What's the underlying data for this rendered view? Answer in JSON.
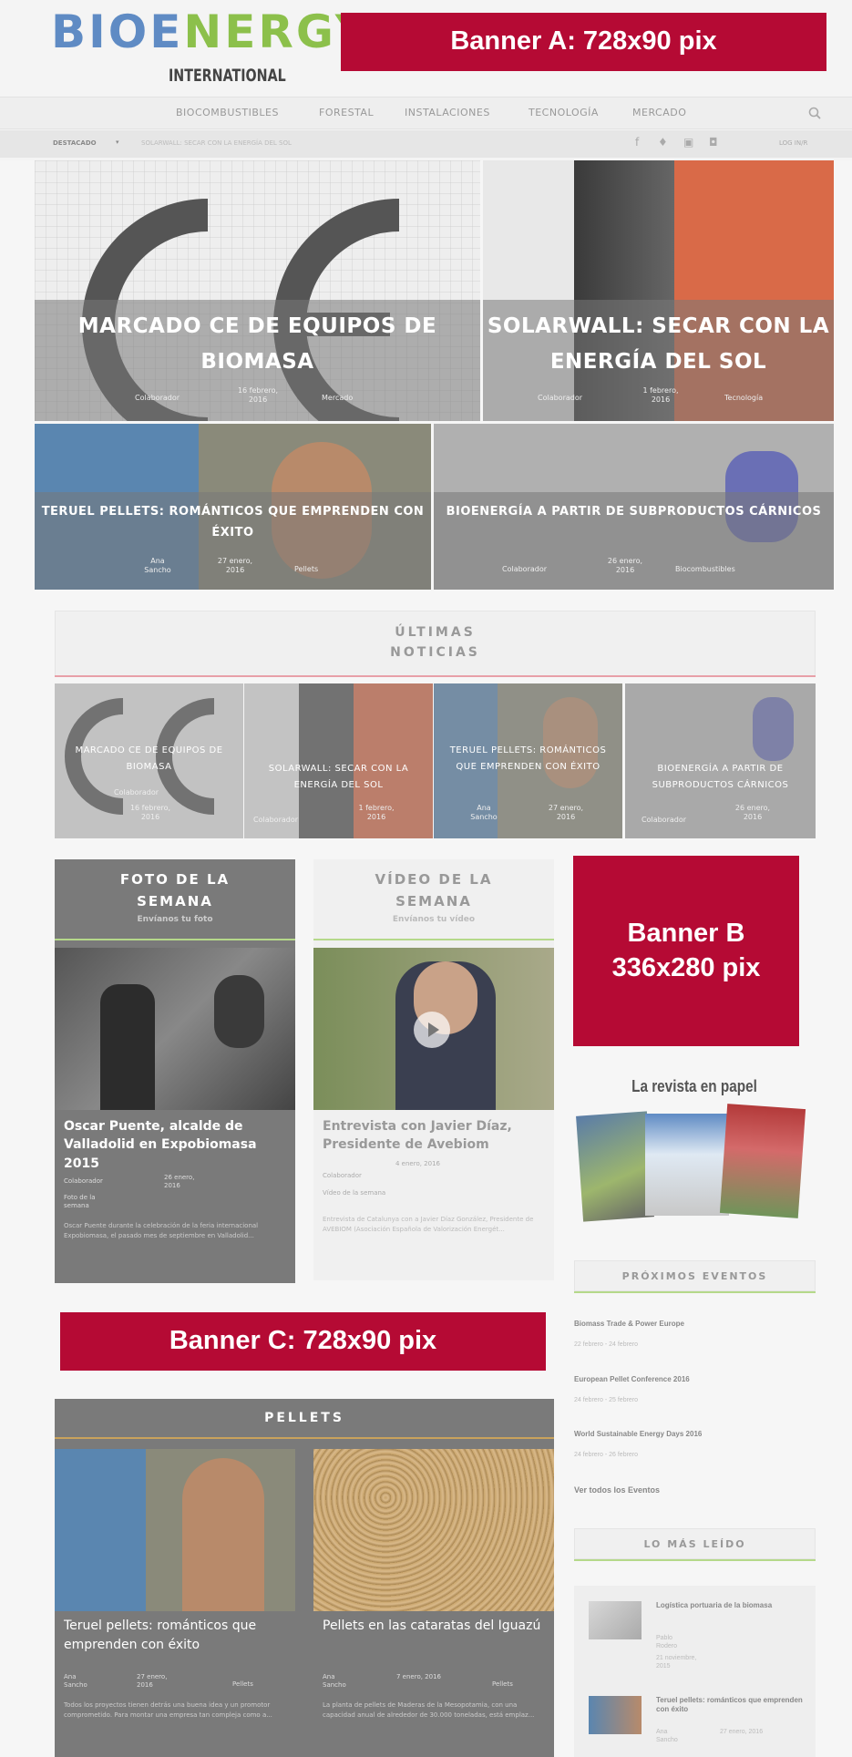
{
  "header": {
    "logo_top": "BIOENERGY",
    "logo_bottom": "INTERNATIONAL",
    "banner_a": "Banner A: 728x90 pix"
  },
  "nav": {
    "items": [
      "BIOCOMBUSTIBLES",
      "FORESTAL",
      "INSTALACIONES",
      "TECNOLOGÍA",
      "MERCADO"
    ],
    "search_icon": "search-icon"
  },
  "subnav": {
    "featured": "DESTACADO",
    "featured_item": "SOLARWALL: SECAR CON LA ENERGÍA DEL SOL",
    "login": "LOG IN/R"
  },
  "hero": [
    {
      "title": "MARCADO CE DE EQUIPOS DE BIOMASA",
      "author": "Colaborador",
      "date": "16 febrero, 2016",
      "category": "Mercado"
    },
    {
      "title": "SOLARWALL: SECAR CON LA ENERGÍA DEL SOL",
      "author": "Colaborador",
      "date": "1 febrero, 2016",
      "category": "Tecnología"
    },
    {
      "title": "TERUEL PELLETS: ROMÁNTICOS QUE EMPRENDEN CON ÉXITO",
      "author": "Ana Sancho",
      "date": "27 enero, 2016",
      "category": "Pellets"
    },
    {
      "title": "BIOENERGÍA A PARTIR DE SUBPRODUCTOS CÁRNICOS",
      "author": "Colaborador",
      "date": "26 enero, 2016",
      "category": "Biocombustibles"
    }
  ],
  "latest": {
    "heading_l1": "ÚLTIMAS",
    "heading_l2": "NOTICIAS",
    "items": [
      {
        "title": "MARCADO CE DE EQUIPOS DE BIOMASA",
        "author": "Colaborador",
        "date": "16 febrero, 2016"
      },
      {
        "title": "SOLARWALL: SECAR CON LA ENERGÍA DEL SOL",
        "author": "Colaborador",
        "date": "1 febrero, 2016"
      },
      {
        "title": "TERUEL PELLETS: ROMÁNTICOS QUE EMPRENDEN CON ÉXITO",
        "author": "Ana Sancho",
        "date": "27 enero, 2016"
      },
      {
        "title": "BIOENERGÍA A PARTIR DE SUBPRODUCTOS CÁRNICOS",
        "author": "Colaborador",
        "date": "26 enero, 2016"
      }
    ]
  },
  "photo": {
    "head": "FOTO DE LA SEMANA",
    "sub": "Envíanos tu foto",
    "title": "Oscar Puente, alcalde de Valladolid en Expobiomasa 2015",
    "author": "Colaborador",
    "date": "26 enero, 2016",
    "category": "Foto de la semana",
    "excerpt": "Oscar Puente durante la celebración de la feria internacional Expobiomasa, el pasado mes de septiembre en Valladolid..."
  },
  "video": {
    "head": "VÍDEO DE LA SEMANA",
    "sub": "Envíanos tu vídeo",
    "title": "Entrevista con Javier Díaz, Presidente de Avebiom",
    "author": "Colaborador",
    "date": "4 enero, 2016",
    "category": "Vídeo de la semana",
    "excerpt": "Entrevista de Catalunya con a Javier Díaz González, Presidente de AVEBIOM (Asociación Española de Valorización Energét..."
  },
  "banner_b": {
    "l1": "Banner B",
    "l2": "336x280 pix"
  },
  "magazine": {
    "title": "La revista en papel"
  },
  "events": {
    "head": "PRÓXIMOS EVENTOS",
    "items": [
      {
        "name": "Biomass Trade & Power Europe",
        "date": "22 febrero - 24 febrero"
      },
      {
        "name": "European Pellet Conference 2016",
        "date": "24 febrero - 25 febrero"
      },
      {
        "name": "World Sustainable Energy Days 2016",
        "date": "24 febrero - 26 febrero"
      }
    ],
    "all": "Ver todos los Eventos"
  },
  "banner_c": "Banner C: 728x90 pix",
  "pellets": {
    "head": "PELLETS",
    "items": [
      {
        "title": "Teruel pellets: románticos que emprenden con éxito",
        "author": "Ana Sancho",
        "date": "27 enero, 2016",
        "category": "Pellets",
        "excerpt": "Todos los proyectos tienen detrás una buena idea y un promotor comprometido. Para montar una empresa tan compleja como a..."
      },
      {
        "title": "Pellets en las cataratas del Iguazú",
        "author": "Ana Sancho",
        "date": "7 enero, 2016",
        "category": "Pellets",
        "excerpt": "La planta de pellets de Maderas de la Mesopotamia, con una capacidad anual de alrededor de 30.000 toneladas, está emplaz..."
      }
    ]
  },
  "mostread": {
    "head": "LO MÁS LEÍDO",
    "items": [
      {
        "title": "Logística portuaria de la biomasa",
        "author": "Pablo Rodero",
        "date": "21 noviembre, 2015"
      },
      {
        "title": "Teruel pellets: románticos que emprenden con éxito",
        "author": "Ana Sancho",
        "date": "27 enero, 2016"
      }
    ]
  }
}
